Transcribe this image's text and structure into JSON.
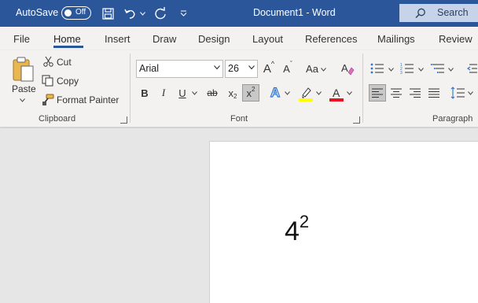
{
  "titlebar": {
    "autosave_label": "AutoSave",
    "autosave_state": "Off",
    "doc_title": "Document1  -  Word",
    "search_label": "Search"
  },
  "tabs": [
    "File",
    "Home",
    "Insert",
    "Draw",
    "Design",
    "Layout",
    "References",
    "Mailings",
    "Review"
  ],
  "active_tab": "Home",
  "clipboard": {
    "paste": "Paste",
    "cut": "Cut",
    "copy": "Copy",
    "format_painter": "Format Painter",
    "group_label": "Clipboard"
  },
  "font": {
    "family": "Arial",
    "size": "26",
    "group_label": "Font",
    "bold": "B",
    "italic": "I",
    "underline": "U",
    "strikethrough": "ab",
    "subscript": "x",
    "subscript_mark": "2",
    "superscript": "x",
    "superscript_mark": "2",
    "grow": "A",
    "shrink": "A",
    "change_case": "Aa",
    "text_effects": "A",
    "font_color": "A",
    "highlight_color": "#ffff00",
    "font_color_value": "#e81123"
  },
  "paragraph": {
    "group_label": "Paragraph"
  },
  "document": {
    "base": "4",
    "superscript": "2"
  },
  "colors": {
    "accent": "#2b579a"
  }
}
